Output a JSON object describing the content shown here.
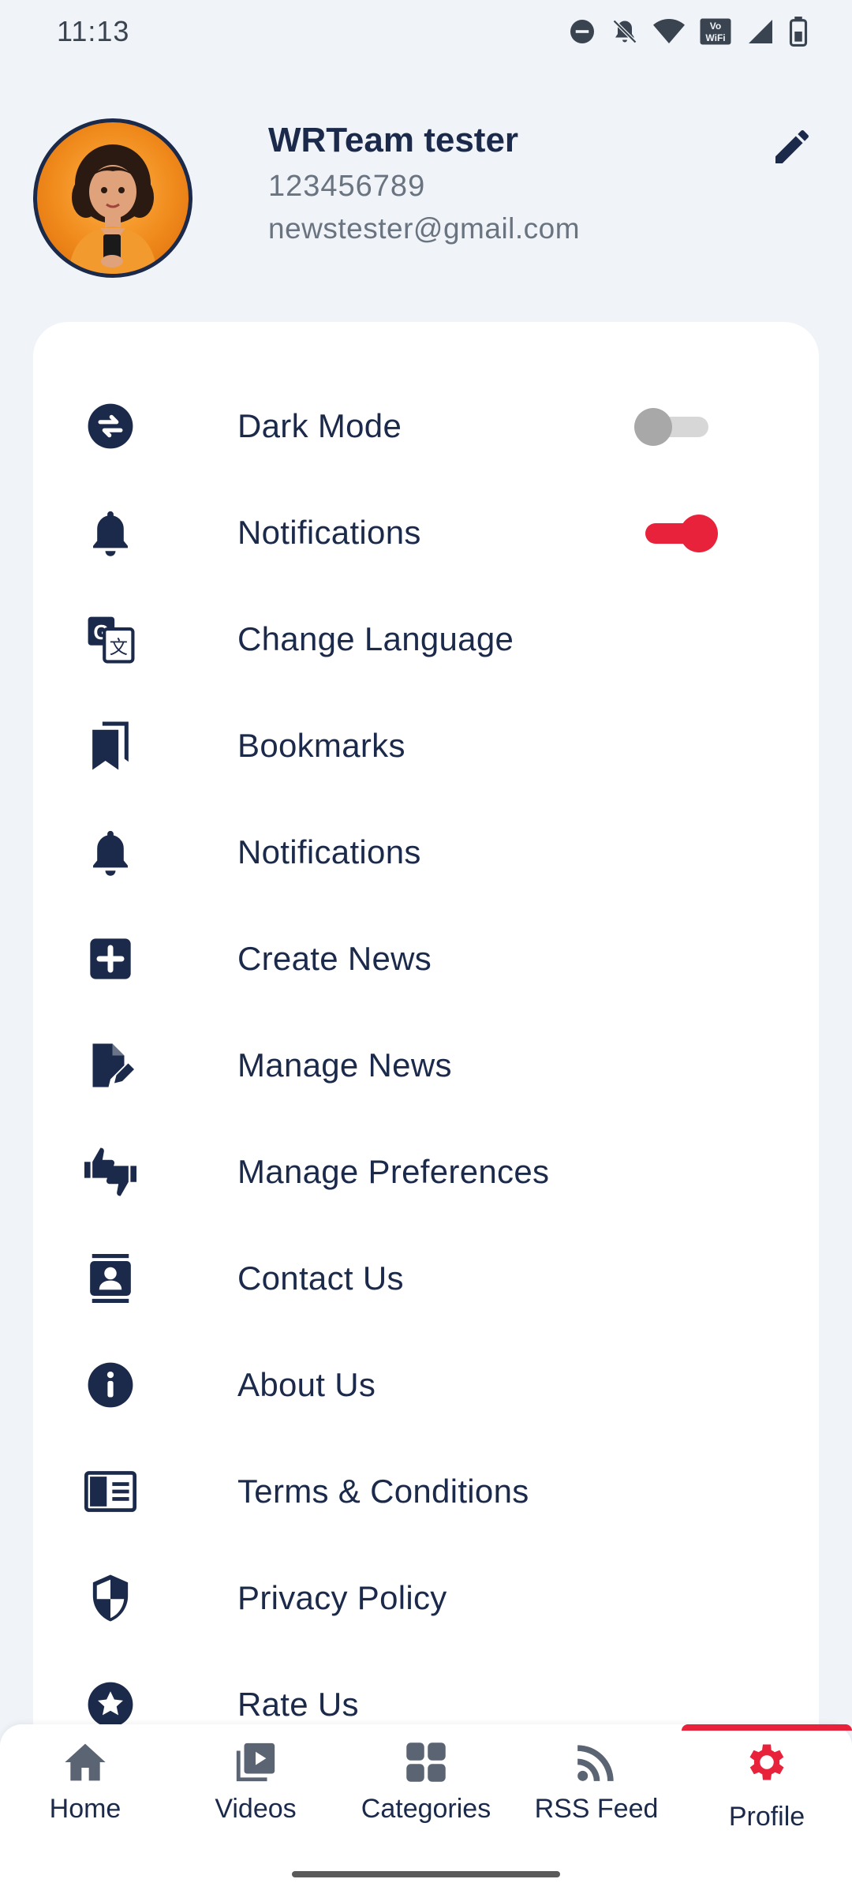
{
  "status_bar": {
    "time": "11:13",
    "icons": [
      "do-not-disturb-icon",
      "bell-off-icon",
      "wifi-icon",
      "vowifi-icon",
      "signal-icon",
      "battery-icon"
    ]
  },
  "profile": {
    "name": "WRTeam tester",
    "phone": "123456789",
    "email": "newstester@gmail.com",
    "avatar_icon": "avatar-illustration",
    "edit_icon": "pencil-icon"
  },
  "menu": {
    "items": [
      {
        "label": "Dark Mode",
        "icon": "swap-circle-icon",
        "toggle": "off"
      },
      {
        "label": "Notifications",
        "icon": "bell-icon",
        "toggle": "on"
      },
      {
        "label": "Change Language",
        "icon": "translate-icon"
      },
      {
        "label": "Bookmarks",
        "icon": "bookmarks-icon"
      },
      {
        "label": "Notifications",
        "icon": "bell-icon"
      },
      {
        "label": "Create News",
        "icon": "plus-square-icon"
      },
      {
        "label": "Manage News",
        "icon": "edit-document-icon"
      },
      {
        "label": "Manage Preferences",
        "icon": "thumbs-up-down-icon"
      },
      {
        "label": "Contact Us",
        "icon": "contact-card-icon"
      },
      {
        "label": "About Us",
        "icon": "info-icon"
      },
      {
        "label": "Terms & Conditions",
        "icon": "book-open-icon"
      },
      {
        "label": "Privacy Policy",
        "icon": "shield-icon"
      },
      {
        "label": "Rate Us",
        "icon": "star-circle-icon"
      }
    ]
  },
  "bottom_nav": {
    "items": [
      {
        "label": "Home",
        "icon": "home-icon"
      },
      {
        "label": "Videos",
        "icon": "video-library-icon"
      },
      {
        "label": "Categories",
        "icon": "grid-icon"
      },
      {
        "label": "RSS Feed",
        "icon": "rss-icon"
      },
      {
        "label": "Profile",
        "icon": "gear-icon",
        "active": true
      }
    ]
  },
  "colors": {
    "background": "#f0f4f8",
    "card": "#ffffff",
    "primary_text": "#1b2a4a",
    "secondary_text": "#6a7380",
    "accent": "#e8223a"
  }
}
